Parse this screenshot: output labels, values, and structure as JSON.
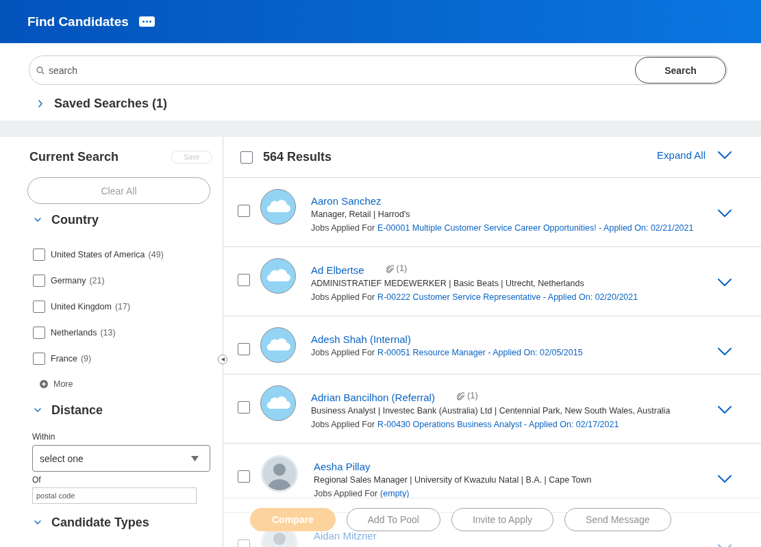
{
  "header": {
    "title": "Find Candidates"
  },
  "search": {
    "placeholder": "search",
    "button": "Search"
  },
  "saved_searches": {
    "label": "Saved Searches (1)",
    "expanded": false
  },
  "current_search": {
    "title": "Current Search",
    "save": {
      "label": "Save",
      "disabled": true
    },
    "clear_all": {
      "label": "Clear All",
      "disabled": true
    }
  },
  "filters": [
    {
      "kind": "checklist",
      "title": "Country",
      "expanded": true,
      "options": [
        {
          "label": "United States of America",
          "count": "(49)",
          "checked": false
        },
        {
          "label": "Germany",
          "count": "(21)",
          "checked": false
        },
        {
          "label": "United Kingdom",
          "count": "(17)",
          "checked": false
        },
        {
          "label": "Netherlands",
          "count": "(13)",
          "checked": false
        },
        {
          "label": "France",
          "count": "(9)",
          "checked": false
        }
      ],
      "more": "More"
    },
    {
      "kind": "distance",
      "title": "Distance",
      "expanded": true,
      "within_label": "Within",
      "within_placeholder": "select one",
      "of_label": "Of",
      "of_placeholder": "postal code"
    },
    {
      "kind": "heading",
      "title": "Candidate Types",
      "expanded": true
    }
  ],
  "results": {
    "count": "564 Results",
    "all_checked": false,
    "expand_all": "Expand All",
    "candidates": [
      {
        "name": "Aaron Sanchez",
        "kind": "cloud",
        "checked": false,
        "expanded": false,
        "details": "Manager, Retail | Harrod's",
        "jobs_label": "Jobs Applied For",
        "jobs": "E-00001 Multiple Customer Service Career Opportunities! - Applied On: 02/21/2021"
      },
      {
        "name": "Ad Elbertse",
        "kind": "cloud",
        "attachments": "(1)",
        "checked": false,
        "expanded": false,
        "details": "ADMINISTRATIEF MEDEWERKER | Basic Beats | Utrecht, Netherlands",
        "jobs_label": "Jobs Applied For",
        "jobs": "R-00222 Customer Service Representative - Applied On: 02/20/2021"
      },
      {
        "name": "Adesh Shah (Internal)",
        "kind": "cloud",
        "checked": false,
        "expanded": false,
        "jobs_label": "Jobs Applied For",
        "jobs": "R-00051 Resource Manager - Applied On: 02/05/2015"
      },
      {
        "name": "Adrian Bancilhon (Referral)",
        "kind": "cloud",
        "attachments": "(1)",
        "checked": false,
        "expanded": false,
        "details": "Business Analyst | Investec Bank (Australia) Ltd | Centennial Park, New South Wales, Australia",
        "jobs_label": "Jobs Applied For",
        "jobs": "R-00430 Operations Business Analyst - Applied On: 02/17/2021"
      },
      {
        "name": "Aesha Pillay",
        "kind": "photo",
        "checked": false,
        "expanded": false,
        "details": "Regional Sales Manager | University of Kwazulu Natal | B.A. | Cape Town",
        "jobs_label": "Jobs Applied For",
        "jobs": "(empty)"
      },
      {
        "name": "Aidan Mitzner",
        "kind": "photo",
        "checked": false,
        "expanded": false
      }
    ]
  },
  "actions": [
    {
      "label": "Compare",
      "kind": "primary",
      "disabled": true
    },
    {
      "label": "Add To Pool",
      "kind": "secondary",
      "disabled": true
    },
    {
      "label": "Invite to Apply",
      "kind": "secondary",
      "disabled": true
    },
    {
      "label": "Send Message",
      "kind": "secondary",
      "disabled": true
    }
  ]
}
